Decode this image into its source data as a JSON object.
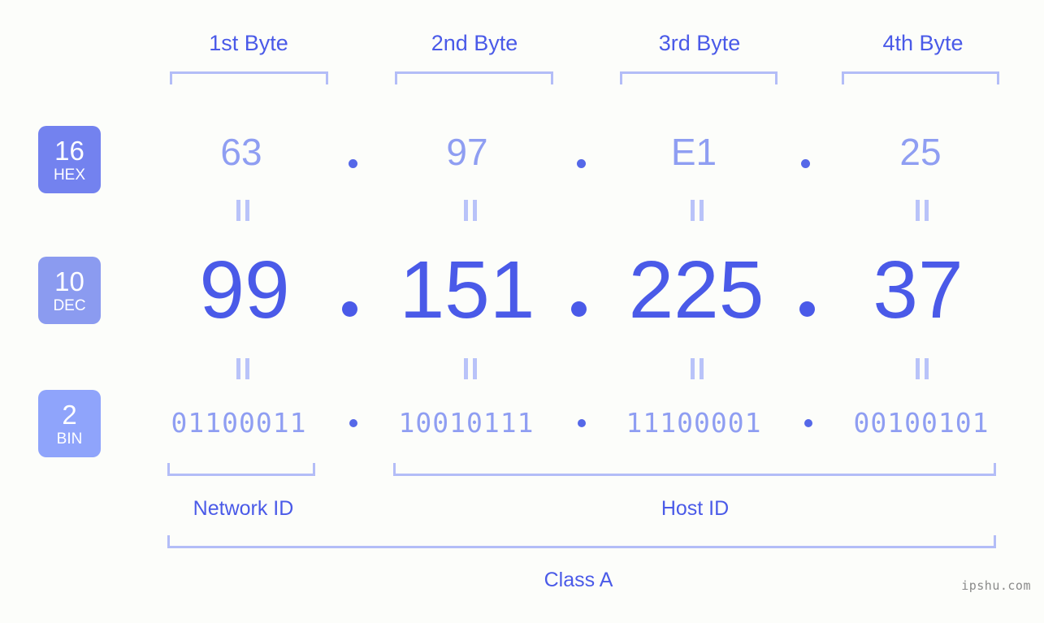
{
  "byte_headers": [
    {
      "label": "1st Byte"
    },
    {
      "label": "2nd Byte"
    },
    {
      "label": "3rd Byte"
    },
    {
      "label": "4th Byte"
    }
  ],
  "bases": {
    "hex": {
      "number": "16",
      "name": "HEX",
      "color": "#7382ef"
    },
    "dec": {
      "number": "10",
      "name": "DEC",
      "color": "#8b9bf0"
    },
    "bin": {
      "number": "2",
      "name": "BIN",
      "color": "#8fa4fb"
    }
  },
  "rows": {
    "hex": {
      "octets": [
        "63",
        "97",
        "E1",
        "25"
      ],
      "separator": "."
    },
    "dec": {
      "octets": [
        "99",
        "151",
        "225",
        "37"
      ],
      "separator": "."
    },
    "bin": {
      "octets": [
        "01100011",
        "10010111",
        "11100001",
        "00100101"
      ],
      "separator": "."
    }
  },
  "sections": {
    "network_id": "Network ID",
    "host_id": "Host ID",
    "class": "Class A"
  },
  "watermark": "ipshu.com",
  "colors": {
    "background": "#fcfdfa",
    "accent_strong": "#4a5ae8",
    "accent_mid": "#8f9ef2",
    "bracket": "#b3bdf7",
    "equals": "#b9c3f9",
    "watermark": "#8a8a8a"
  },
  "chart_data": {
    "type": "table",
    "title": "IPv4 address representation: 99.151.225.37 (Class A)",
    "columns": [
      "1st Byte",
      "2nd Byte",
      "3rd Byte",
      "4th Byte"
    ],
    "rows": [
      {
        "base": "16",
        "base_name": "HEX",
        "values": [
          "63",
          "97",
          "E1",
          "25"
        ]
      },
      {
        "base": "10",
        "base_name": "DEC",
        "values": [
          "99",
          "151",
          "225",
          "37"
        ]
      },
      {
        "base": "2",
        "base_name": "BIN",
        "values": [
          "01100011",
          "10010111",
          "11100001",
          "00100101"
        ]
      }
    ],
    "annotations": [
      {
        "label": "Network ID",
        "spans_bytes": [
          1
        ]
      },
      {
        "label": "Host ID",
        "spans_bytes": [
          2,
          3,
          4
        ]
      },
      {
        "label": "Class A",
        "spans_bytes": [
          1,
          2,
          3,
          4
        ]
      }
    ]
  }
}
